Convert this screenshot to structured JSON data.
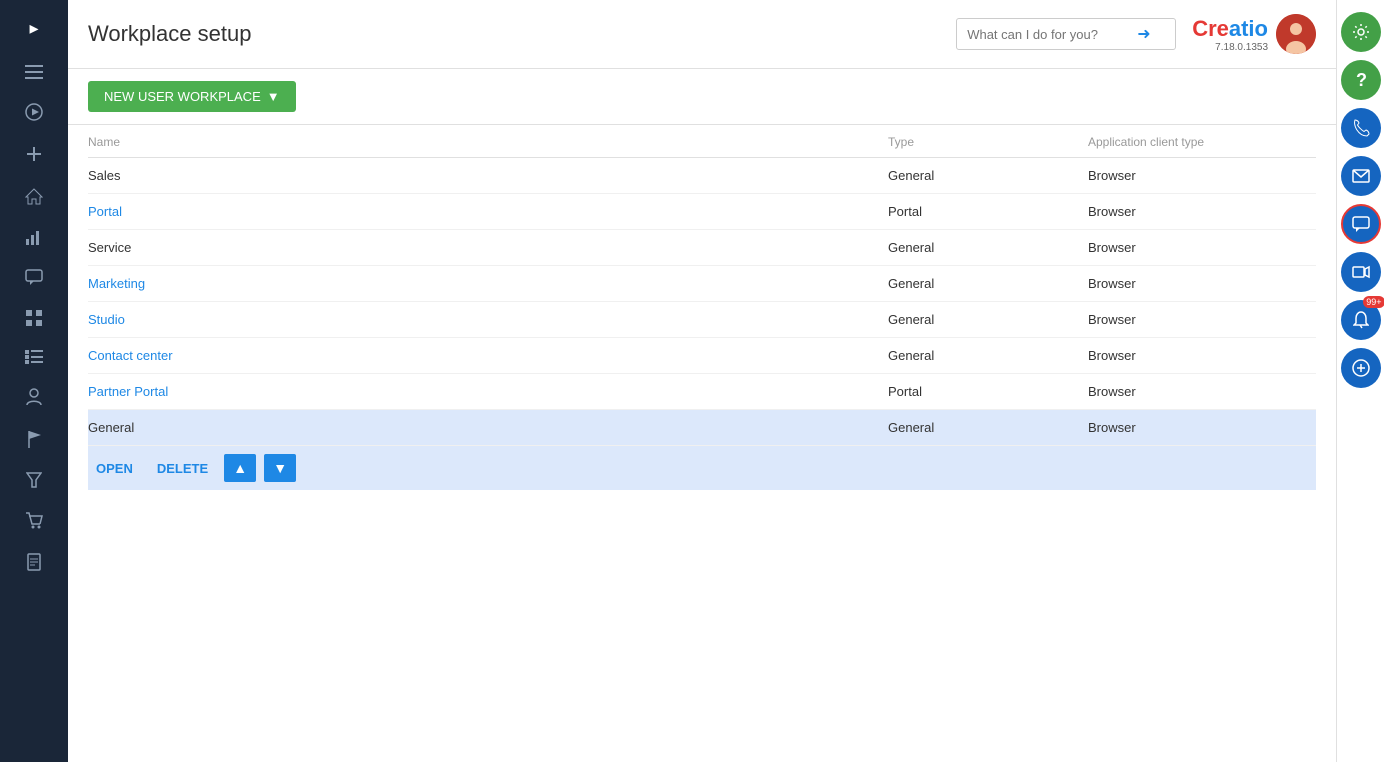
{
  "page": {
    "title": "Workplace setup"
  },
  "search": {
    "placeholder": "What can I do for you?"
  },
  "logo": {
    "text": "Creatio",
    "version": "7.18.0.1353"
  },
  "toolbar": {
    "new_button_label": "NEW USER WORKPLACE"
  },
  "table": {
    "columns": [
      "Name",
      "Type",
      "Application client type"
    ],
    "rows": [
      {
        "name": "Sales",
        "type": "General",
        "client_type": "Browser",
        "link": false,
        "selected": false
      },
      {
        "name": "Portal",
        "type": "Portal",
        "client_type": "Browser",
        "link": true,
        "selected": false
      },
      {
        "name": "Service",
        "type": "General",
        "client_type": "Browser",
        "link": false,
        "selected": false
      },
      {
        "name": "Marketing",
        "type": "General",
        "client_type": "Browser",
        "link": true,
        "selected": false
      },
      {
        "name": "Studio",
        "type": "General",
        "client_type": "Browser",
        "link": true,
        "selected": false
      },
      {
        "name": "Contact center",
        "type": "General",
        "client_type": "Browser",
        "link": true,
        "selected": false
      },
      {
        "name": "Partner Portal",
        "type": "Portal",
        "client_type": "Browser",
        "link": true,
        "selected": false
      },
      {
        "name": "General",
        "type": "General",
        "client_type": "Browser",
        "link": false,
        "selected": true
      }
    ]
  },
  "actions": {
    "open_label": "OPEN",
    "delete_label": "DELETE"
  },
  "sidebar": {
    "icons": [
      "chevron-right",
      "menu",
      "play-circle",
      "plus",
      "home",
      "bar-chart",
      "chat",
      "grid",
      "list",
      "person",
      "flag",
      "funnel",
      "cart",
      "doc"
    ]
  },
  "right_panel": {
    "notifications_badge": "99+"
  }
}
